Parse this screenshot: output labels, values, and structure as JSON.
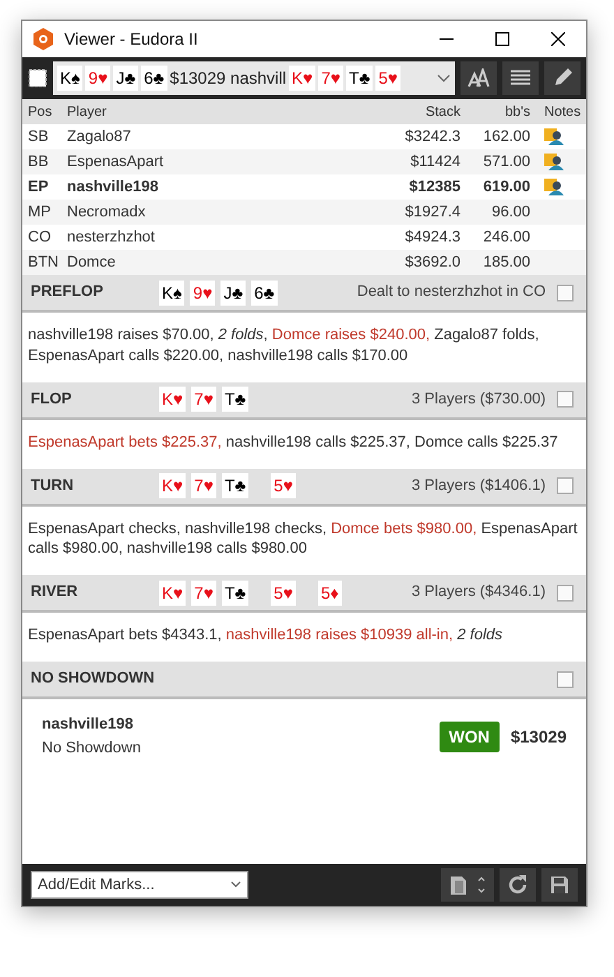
{
  "window": {
    "title": "Viewer - Eudora II"
  },
  "toolbar": {
    "hole_cards": [
      {
        "label": "K♠",
        "color": "#000000"
      },
      {
        "label": "9♥",
        "color": "#e8101a"
      },
      {
        "label": "J♣",
        "color": "#000000"
      },
      {
        "label": "6♣",
        "color": "#000000"
      }
    ],
    "summary": "$13029 nashvill",
    "board": [
      {
        "label": "K♥",
        "color": "#e8101a"
      },
      {
        "label": "7♥",
        "color": "#e8101a"
      },
      {
        "label": "T♣",
        "color": "#000000"
      },
      {
        "label": "5♥",
        "color": "#e8101a"
      }
    ]
  },
  "table": {
    "columns": [
      "Pos",
      "Player",
      "Stack",
      "bb's",
      "Notes"
    ],
    "rows": [
      {
        "pos": "SB",
        "player": "Zagalo87",
        "stack": "$3242.3",
        "bb": "162.00",
        "has_note": true,
        "hero": false
      },
      {
        "pos": "BB",
        "player": "EspenasApart",
        "stack": "$11424",
        "bb": "571.00",
        "has_note": true,
        "hero": false
      },
      {
        "pos": "EP",
        "player": "nashville198",
        "stack": "$12385",
        "bb": "619.00",
        "has_note": true,
        "hero": true
      },
      {
        "pos": "MP",
        "player": "Necromadx",
        "stack": "$1927.4",
        "bb": "96.00",
        "has_note": false,
        "hero": false
      },
      {
        "pos": "CO",
        "player": "nesterzhzhot",
        "stack": "$4924.3",
        "bb": "246.00",
        "has_note": false,
        "hero": false
      },
      {
        "pos": "BTN",
        "player": "Domce",
        "stack": "$3692.0",
        "bb": "185.00",
        "has_note": false,
        "hero": false
      }
    ]
  },
  "streets": [
    {
      "name": "PREFLOP",
      "card_groups": [
        [
          {
            "label": "K♠",
            "color": "#000000"
          },
          {
            "label": "9♥",
            "color": "#e8101a"
          },
          {
            "label": "J♣",
            "color": "#000000"
          },
          {
            "label": "6♣",
            "color": "#000000"
          }
        ]
      ],
      "info": "Dealt to nesterzhzhot in CO",
      "checked": false,
      "actions": [
        {
          "text": "nashville198 raises $70.00, ",
          "kind": "plain"
        },
        {
          "text": "2 folds",
          "kind": "fold"
        },
        {
          "text": ", ",
          "kind": "plain"
        },
        {
          "text": "Domce raises $240.00,",
          "kind": "aggressive"
        },
        {
          "text": " Zagalo87 folds, EspenasApart calls $220.00, nashville198 calls $170.00",
          "kind": "plain"
        }
      ]
    },
    {
      "name": "FLOP",
      "card_groups": [
        [
          {
            "label": "K♥",
            "color": "#e8101a"
          },
          {
            "label": "7♥",
            "color": "#e8101a"
          },
          {
            "label": "T♣",
            "color": "#000000"
          }
        ]
      ],
      "info": "3 Players ($730.00)",
      "checked": false,
      "actions": [
        {
          "text": "EspenasApart bets $225.37,",
          "kind": "aggressive"
        },
        {
          "text": " nashville198 calls $225.37, Domce calls $225.37",
          "kind": "plain"
        }
      ]
    },
    {
      "name": "TURN",
      "card_groups": [
        [
          {
            "label": "K♥",
            "color": "#e8101a"
          },
          {
            "label": "7♥",
            "color": "#e8101a"
          },
          {
            "label": "T♣",
            "color": "#000000"
          }
        ],
        [
          {
            "label": "5♥",
            "color": "#e8101a"
          }
        ]
      ],
      "info": "3 Players ($1406.1)",
      "checked": false,
      "actions": [
        {
          "text": "EspenasApart checks, nashville198 checks, ",
          "kind": "plain"
        },
        {
          "text": "Domce bets $980.00,",
          "kind": "aggressive"
        },
        {
          "text": " EspenasApart calls $980.00, nashville198 calls $980.00",
          "kind": "plain"
        }
      ]
    },
    {
      "name": "RIVER",
      "card_groups": [
        [
          {
            "label": "K♥",
            "color": "#e8101a"
          },
          {
            "label": "7♥",
            "color": "#e8101a"
          },
          {
            "label": "T♣",
            "color": "#000000"
          }
        ],
        [
          {
            "label": "5♥",
            "color": "#e8101a"
          }
        ],
        [
          {
            "label": "5♦",
            "color": "#e8101a"
          }
        ]
      ],
      "info": "3 Players ($4346.1)",
      "checked": false,
      "actions": [
        {
          "text": "EspenasApart bets $4343.1, ",
          "kind": "plain"
        },
        {
          "text": "nashville198 raises $10939 all-in, ",
          "kind": "aggressive"
        },
        {
          "text": "2 folds",
          "kind": "fold"
        }
      ]
    },
    {
      "name": "NO SHOWDOWN",
      "checked": false
    }
  ],
  "result": {
    "player": "nashville198",
    "description": "No Showdown",
    "badge": "WON",
    "amount": "$13029"
  },
  "footer": {
    "marks_select": "Add/Edit Marks..."
  }
}
